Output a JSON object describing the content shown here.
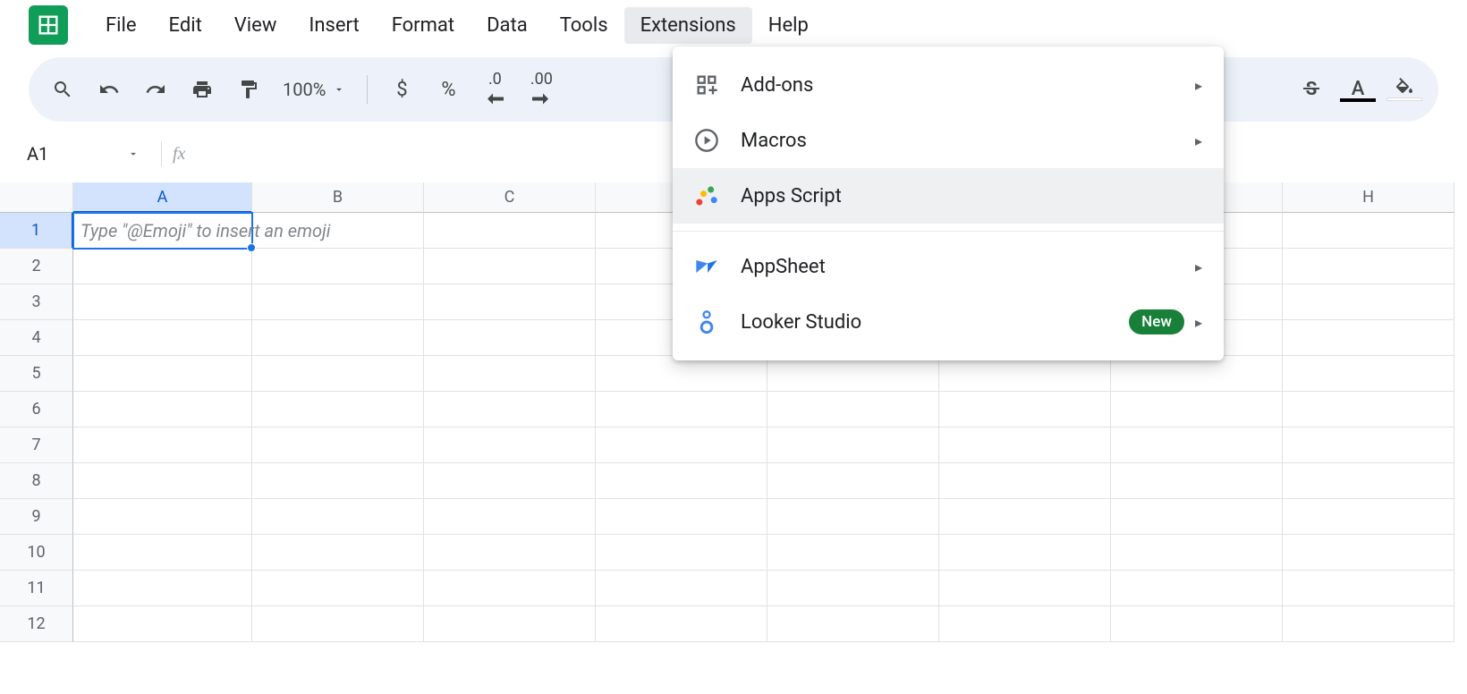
{
  "menus": {
    "file": "File",
    "edit": "Edit",
    "view": "View",
    "insert": "Insert",
    "format": "Format",
    "data": "Data",
    "tools": "Tools",
    "extensions": "Extensions",
    "help": "Help"
  },
  "toolbar": {
    "zoom": "100%",
    "currency": "$",
    "percent": "%",
    "dec_decrease": ".0",
    "dec_increase": ".00"
  },
  "namebox": {
    "value": "A1",
    "fx": "fx"
  },
  "grid": {
    "columns": [
      "A",
      "B",
      "C",
      "",
      "",
      "",
      "",
      "H"
    ],
    "rows": [
      "1",
      "2",
      "3",
      "4",
      "5",
      "6",
      "7",
      "8",
      "9",
      "10",
      "11",
      "12"
    ],
    "placeholder": "Type \"@Emoji\" to insert an emoji",
    "selected_cell": "A1"
  },
  "extensions_menu": {
    "addons": "Add-ons",
    "macros": "Macros",
    "apps_script": "Apps Script",
    "appsheet": "AppSheet",
    "looker": "Looker Studio",
    "new_badge": "New"
  }
}
